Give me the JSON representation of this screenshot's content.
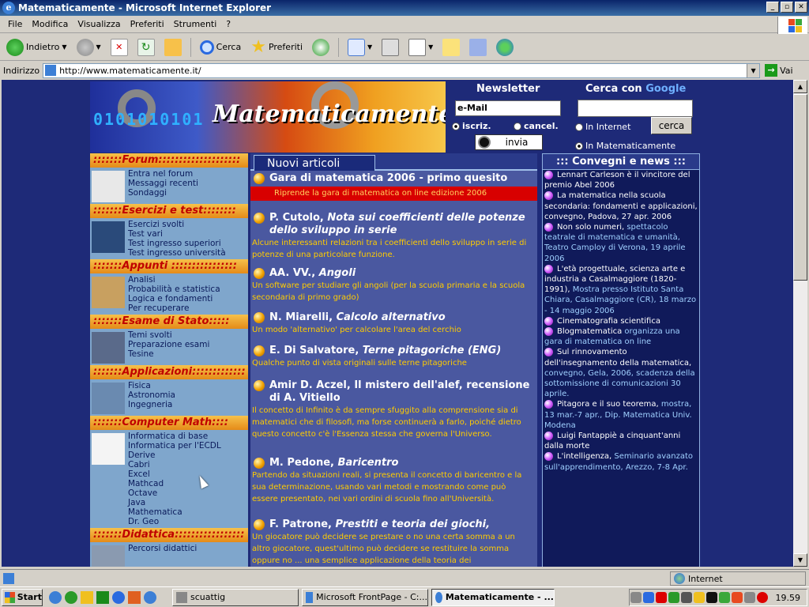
{
  "window": {
    "title": "Matematicamente - Microsoft Internet Explorer"
  },
  "menu": [
    "File",
    "Modifica",
    "Visualizza",
    "Preferiti",
    "Strumenti",
    "?"
  ],
  "toolbar": {
    "back": "Indietro",
    "search": "Cerca",
    "favorites": "Preferiti"
  },
  "address": {
    "label": "Indirizzo",
    "url": "http://www.matematicamente.it/",
    "go": "Vai"
  },
  "site": {
    "banner_binary": "0101010101",
    "banner_logo": "Matematicamente.it",
    "newsletter_title": "Newsletter",
    "google_title_prefix": "Cerca con ",
    "google_word": "Google",
    "email_placeholder": "e-Mail",
    "subscribe": "iscriz.",
    "cancel": "cancel.",
    "send": "invia",
    "search_button": "cerca",
    "in_internet": "In Internet",
    "in_site": "In Matematicamente"
  },
  "left_sections": [
    {
      "title": ":::::::Forum::::::::::::::::::::",
      "links": [
        "Entra nel forum",
        "Messaggi recenti",
        "Sondaggi"
      ]
    },
    {
      "title": ":::::::Esercizi e test::::::::",
      "links": [
        "Esercizi svolti",
        "Test vari",
        "Test ingresso superiori",
        "Test ingresso università"
      ]
    },
    {
      "title": ":::::::Appunti ::::::::::::::::",
      "links": [
        "Analisi",
        "Probabilità e statistica",
        "Logica e fondamenti",
        "Per recuperare"
      ]
    },
    {
      "title": ":::::::Esame di Stato:::::",
      "links": [
        "Temi svolti",
        "Preparazione esami",
        "Tesine"
      ]
    },
    {
      "title": ":::::::Applicazioni:::::::::::::",
      "links": [
        "Fisica",
        "Astronomia",
        "Ingegneria"
      ]
    },
    {
      "title": ":::::::Computer Math::::",
      "links": [
        "Informatica di base",
        "Informatica per l'ECDL",
        "Derive",
        "Cabri",
        "Excel",
        "Mathcad",
        "Octave",
        "Java",
        "Mathematica",
        "Dr. Geo"
      ]
    },
    {
      "title": ":::::::Didattica:::::::::::::::::",
      "links": [
        "Percorsi didattici"
      ]
    }
  ],
  "middle": {
    "header": "Nuovi articoli",
    "articles": [
      {
        "author": "",
        "title": "Gara di matematica 2006 - primo quesito",
        "desc": "Riprende la gara di matematica on line edizione 2006"
      },
      {
        "author": "P. Cutolo, ",
        "title": "Nota sui coefficienti delle potenze dello sviluppo in serie",
        "desc": "Alcune interessanti relazioni tra i coefficienti dello sviluppo in serie di potenze di una particolare funzione."
      },
      {
        "author": "AA. VV., ",
        "title": "Angoli",
        "desc": "Un software per studiare gli angoli (per la scuola primaria e la scuola secondaria di primo grado)"
      },
      {
        "author": "N. Miarelli, ",
        "title": "Calcolo alternativo",
        "desc": "Un modo 'alternativo' per calcolare l'area del cerchio"
      },
      {
        "author": "E. Di Salvatore, ",
        "title": "Terne pitagoriche (ENG)",
        "desc": "Qualche punto di vista originali sulle terne pitagoriche"
      },
      {
        "author": "",
        "title": "Amir D. Aczel, Il mistero dell'alef, recensione di A. Vitiello",
        "desc": "Il concetto di Infinito è da sempre sfuggito alla comprensione sia di matematici che di filosofi, ma forse continuerà a farlo, poiché dietro questo concetto c'è l'Essenza stessa che governa l'Universo."
      },
      {
        "author": "M. Pedone, ",
        "title": "Baricentro",
        "desc": "Partendo da situazioni reali, si presenta il concetto di baricentro e la sua determinazione, usando vari metodi e mostrando come può essere presentato, nei vari ordini di scuola fino all'Università."
      },
      {
        "author": "F. Patrone, ",
        "title": "Prestiti e teoria dei giochi,",
        "desc": "Un giocatore può decidere se prestare o no una certa somma a un altro giocatore, quest'ultimo può decidere se restituire la somma oppure no ... una semplice applicazione della teoria dei"
      }
    ]
  },
  "right": {
    "header": "::: Convegni e news :::",
    "items": [
      {
        "text": "Lennart Carleson è il vincitore del premio Abel 2006",
        "extra": ""
      },
      {
        "text": "La matematica nella scuola secondaria: fondamenti e applicazioni, convegno, Padova, 27 apr. 2006",
        "extra": ""
      },
      {
        "text": "Non solo numeri, ",
        "extra": "spettacolo teatrale di matematica e umanità, Teatro Camploy di Verona, 19 aprile 2006"
      },
      {
        "text": "L'età progettuale, scienza arte e industria a Casalmaggiore (1820-1991), ",
        "extra": "Mostra presso Istituto Santa Chiara, Casalmaggiore (CR), 18 marzo - 14 maggio 2006"
      },
      {
        "text": "Cinematografia scientifica",
        "extra": ""
      },
      {
        "text": "Blogmatematica ",
        "extra": "organizza una gara di matematica on line"
      },
      {
        "text": "Sul rinnovamento dell'insegnamento della matematica, ",
        "extra": "convegno, Gela, 2006, scadenza della sottomissione di comunicazioni 30 aprile."
      },
      {
        "text": "Pitagora e il suo teorema, ",
        "extra": "mostra, 13 mar.-7 apr., Dip. Matematica Univ. Modena"
      },
      {
        "text": "Luigi Fantappiè a cinquant'anni dalla morte",
        "extra": ""
      },
      {
        "text": "L'intelligenza, ",
        "extra": "Seminario avanzato sull'apprendimento, Arezzo, 7-8 Apr."
      }
    ]
  },
  "status": {
    "zone": "Internet"
  },
  "taskbar": {
    "start": "Start",
    "tasks": [
      "scuattig",
      "Microsoft FrontPage - C:...",
      "Matematicamente - ..."
    ],
    "clock": "19.59"
  }
}
